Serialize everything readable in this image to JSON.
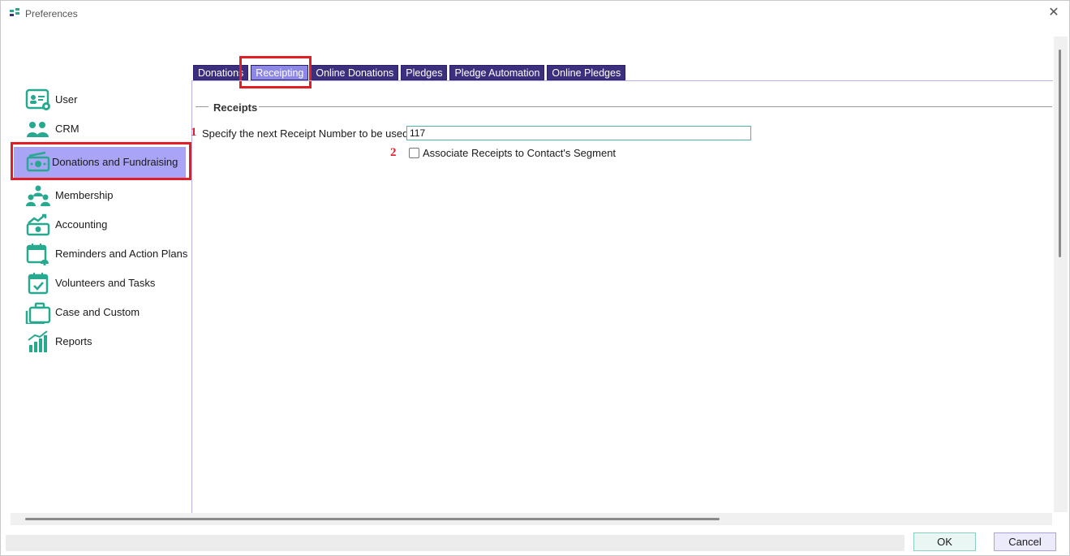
{
  "window": {
    "title": "Preferences",
    "close_glyph": "✕"
  },
  "sidebar": {
    "items": [
      {
        "label": "User",
        "icon": "user-card-icon"
      },
      {
        "label": "CRM",
        "icon": "people-icon"
      },
      {
        "label": "Donations and Fundraising",
        "icon": "money-icon",
        "selected": true
      },
      {
        "label": "Membership",
        "icon": "group-icon"
      },
      {
        "label": "Accounting",
        "icon": "cash-chart-icon"
      },
      {
        "label": "Reminders and Action Plans",
        "icon": "calendar-bell-icon"
      },
      {
        "label": "Volunteers and Tasks",
        "icon": "calendar-check-icon"
      },
      {
        "label": "Case and Custom",
        "icon": "briefcase-icon"
      },
      {
        "label": "Reports",
        "icon": "bar-chart-icon"
      }
    ]
  },
  "tabs": [
    {
      "label": "Donations",
      "active": false
    },
    {
      "label": "Receipting",
      "active": true
    },
    {
      "label": "Online Donations",
      "active": false
    },
    {
      "label": "Pledges",
      "active": false
    },
    {
      "label": "Pledge Automation",
      "active": false
    },
    {
      "label": "Online Pledges",
      "active": false
    }
  ],
  "receipts": {
    "group_title": "Receipts",
    "receipt_number_label": "Specify the next Receipt Number to be used",
    "receipt_number_value": "117",
    "associate_label": "Associate Receipts to Contact's Segment",
    "associate_checked": false
  },
  "annotations": {
    "one": "1",
    "two": "2"
  },
  "buttons": {
    "ok": "OK",
    "cancel": "Cancel"
  },
  "colors": {
    "accent_teal": "#26a98f",
    "tab_dark": "#3b2f7e",
    "tab_active": "#8d88e6",
    "selected_nav": "#a9a4f5",
    "highlight_red": "#e01e26"
  }
}
